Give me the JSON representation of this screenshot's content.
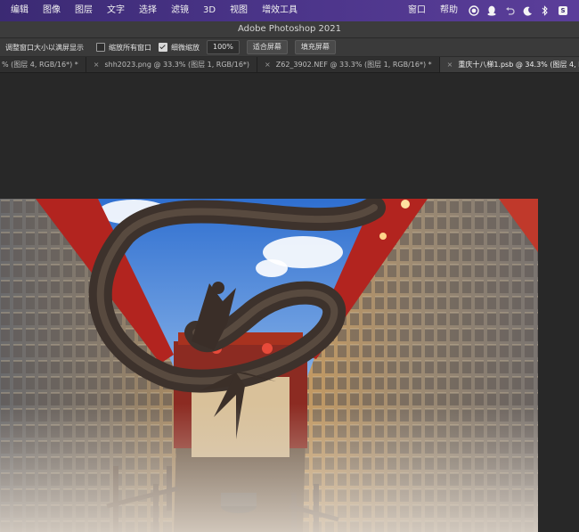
{
  "menubar": {
    "items": [
      "编辑",
      "图像",
      "图层",
      "文字",
      "选择",
      "滤镜",
      "3D",
      "视图",
      "增效工具"
    ],
    "right_items": [
      "窗口",
      "帮助"
    ],
    "status_icons": [
      "record-icon",
      "qq-penguin-icon",
      "undo-arrow-icon",
      "moon-icon",
      "bluetooth-icon",
      "input-method-icon"
    ],
    "input_badge": "S"
  },
  "titlebar": {
    "title": "Adobe Photoshop 2021"
  },
  "options": {
    "fit_window_label": "调整窗口大小以满屏显示",
    "zoom_all_label": "缩放所有窗口",
    "zoom_all_checked": false,
    "scrubby_label": "细微缩放",
    "scrubby_checked": true,
    "zoom_value": "100%",
    "fit_screen_label": "适合屏幕",
    "fill_screen_label": "填充屏幕"
  },
  "tabs": [
    {
      "label": "% (图层 4, RGB/16*) *",
      "active": false,
      "has_close": false
    },
    {
      "label": "shh2023.png @ 33.3% (图层 1, RGB/16*)",
      "active": false,
      "has_close": true
    },
    {
      "label": "Z62_3902.NEF @ 33.3% (图层 1, RGB/16*) *",
      "active": false,
      "has_close": true
    },
    {
      "label": "重庆十八梯1.psb @ 34.3% (图层 4, RGB/16*) *",
      "active": true,
      "has_close": true
    }
  ],
  "colors": {
    "menubar_start": "#3b2a73",
    "menubar_end": "#5b3e9a",
    "panel": "#3a3a3a",
    "workspace": "#282828",
    "sky": "#3f7fd6",
    "wall_red": "#b2241f"
  }
}
